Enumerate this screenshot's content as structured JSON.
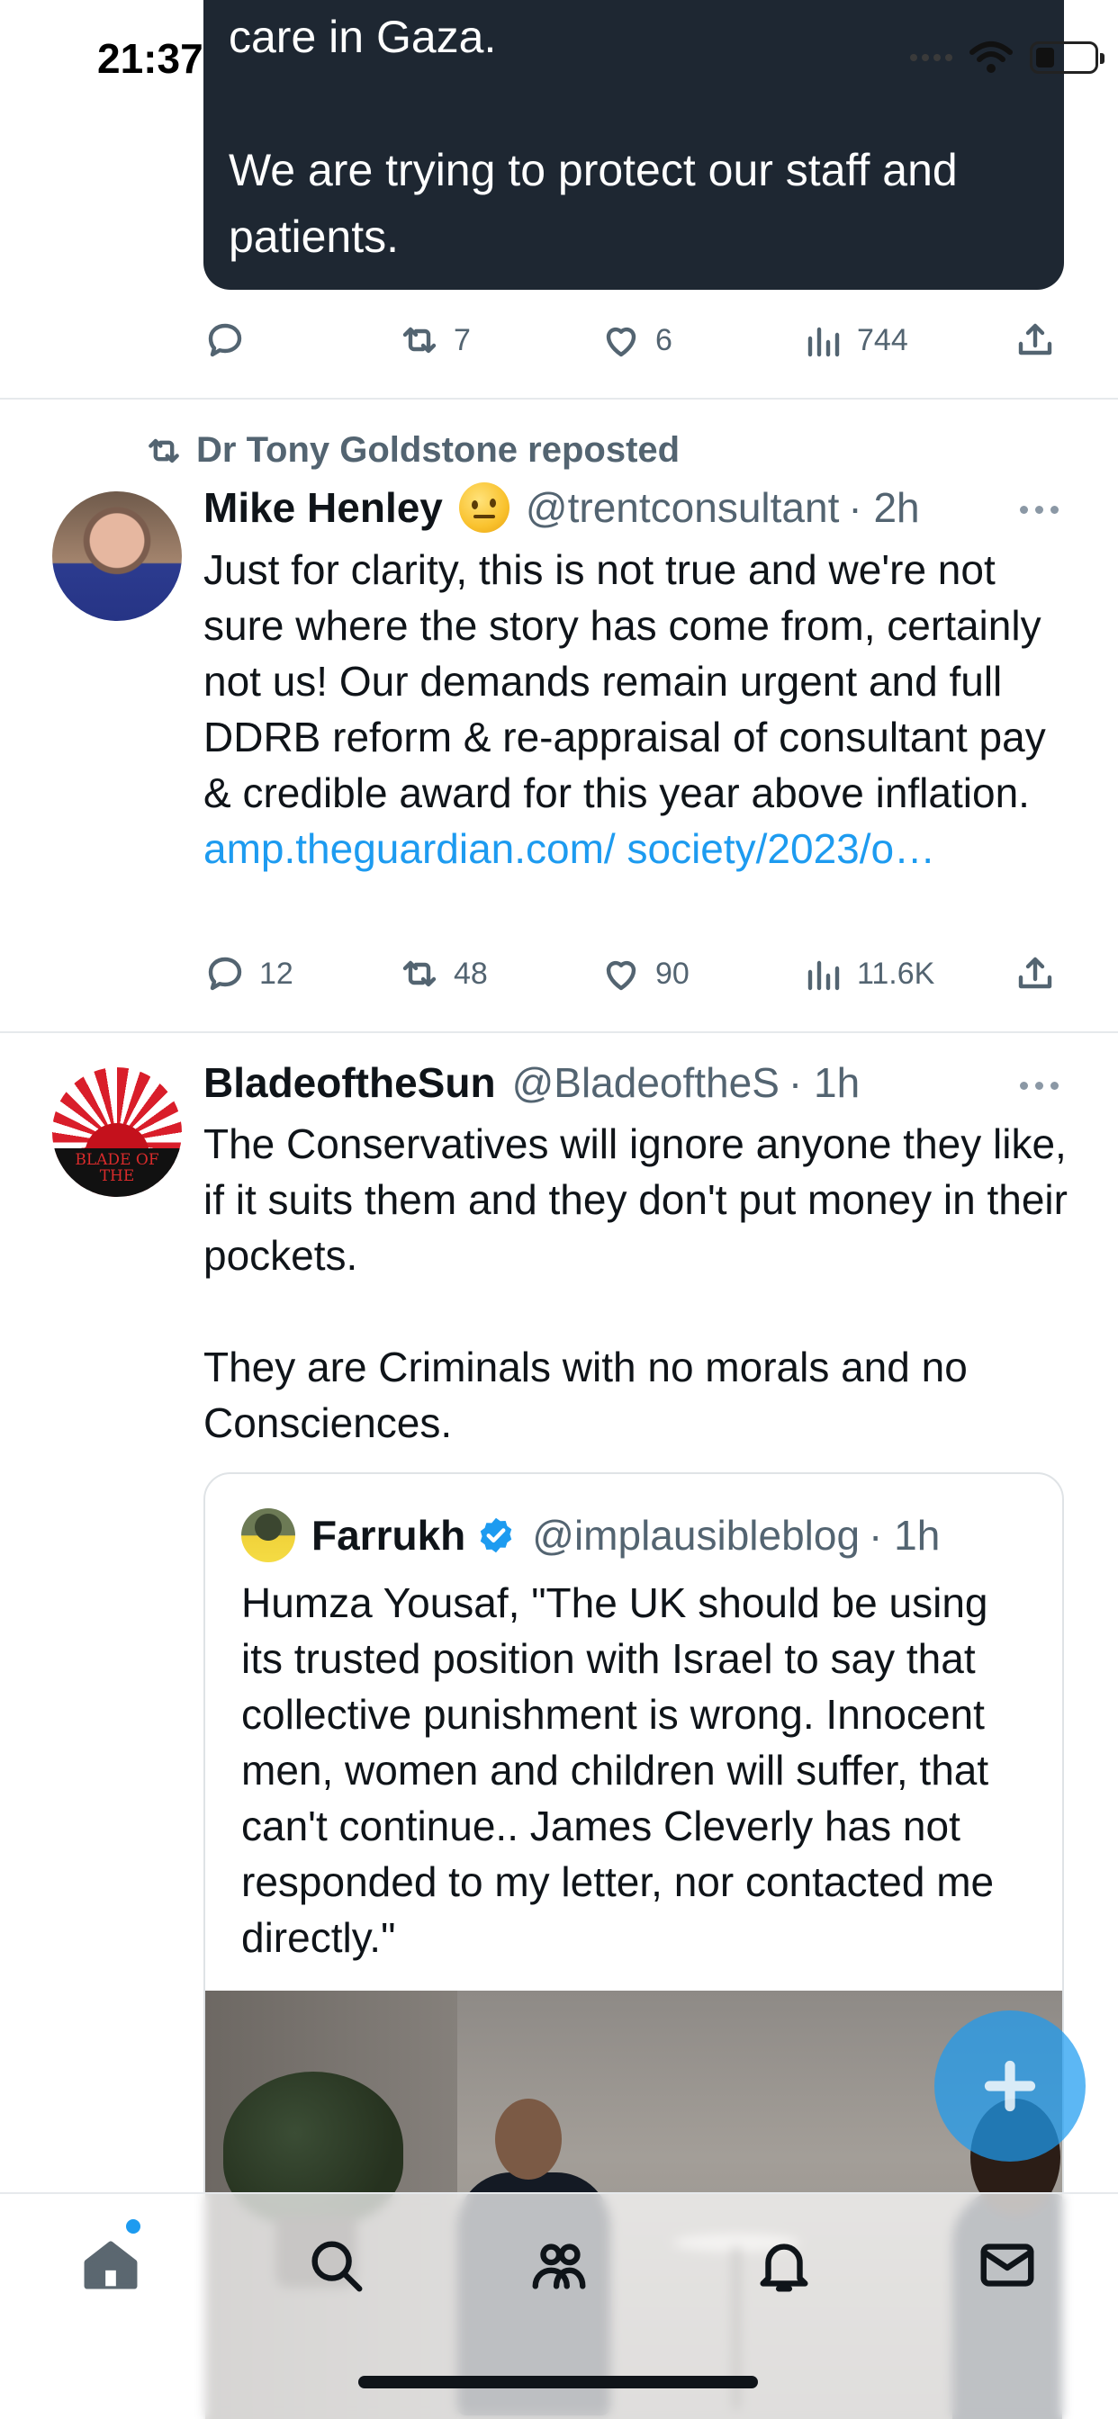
{
  "status_bar": {
    "time": "21:37"
  },
  "top_card": {
    "line1": "care in Gaza.",
    "line2": "We are trying to protect our staff and",
    "line3": "patients."
  },
  "top_actions": {
    "replies": "",
    "reposts": "7",
    "likes": "6",
    "views": "744"
  },
  "tweet1": {
    "reposted_by": "Dr Tony Goldstone reposted",
    "name": "Mike Henley",
    "handle": "@trentconsultant",
    "time": "· 2h",
    "text": "Just for clarity, this is not true and we're not sure where the story has come from, certainly not us! Our demands remain urgent and full DDRB reform & re-appraisal of consultant pay & credible award for this year above inflation. ",
    "link": "amp.theguardian.com/ society/2023/o…",
    "replies": "12",
    "reposts": "48",
    "likes": "90",
    "views": "11.6K"
  },
  "tweet2": {
    "name": "BladeoftheSun",
    "handle": "@BladeoftheS",
    "time": "· 1h",
    "avatar_text": "BLADE OF THE",
    "text_para1": "The Conservatives will ignore anyone they like, if it suits them and they don't put money in their pockets.",
    "text_para2": "They are Criminals with no morals and no Consciences.",
    "quote": {
      "name": "Farrukh",
      "handle": "@implausibleblog",
      "time": "· 1h",
      "text": "Humza Yousaf, \"The UK should be using its trusted position with Israel to say that collective punishment is wrong. Innocent men, women and children will suffer, that can't continue.. James Cleverly has not responded to my letter, nor contacted me directly.\""
    }
  },
  "tab_bar": {
    "items": [
      {
        "icon": "home-icon"
      },
      {
        "icon": "search-icon"
      },
      {
        "icon": "communities-icon"
      },
      {
        "icon": "notifications-icon"
      },
      {
        "icon": "messages-icon"
      }
    ]
  },
  "colors": {
    "accent": "#1d9bf0",
    "secondary_text": "#536471",
    "card_dark": "#1e2732"
  }
}
